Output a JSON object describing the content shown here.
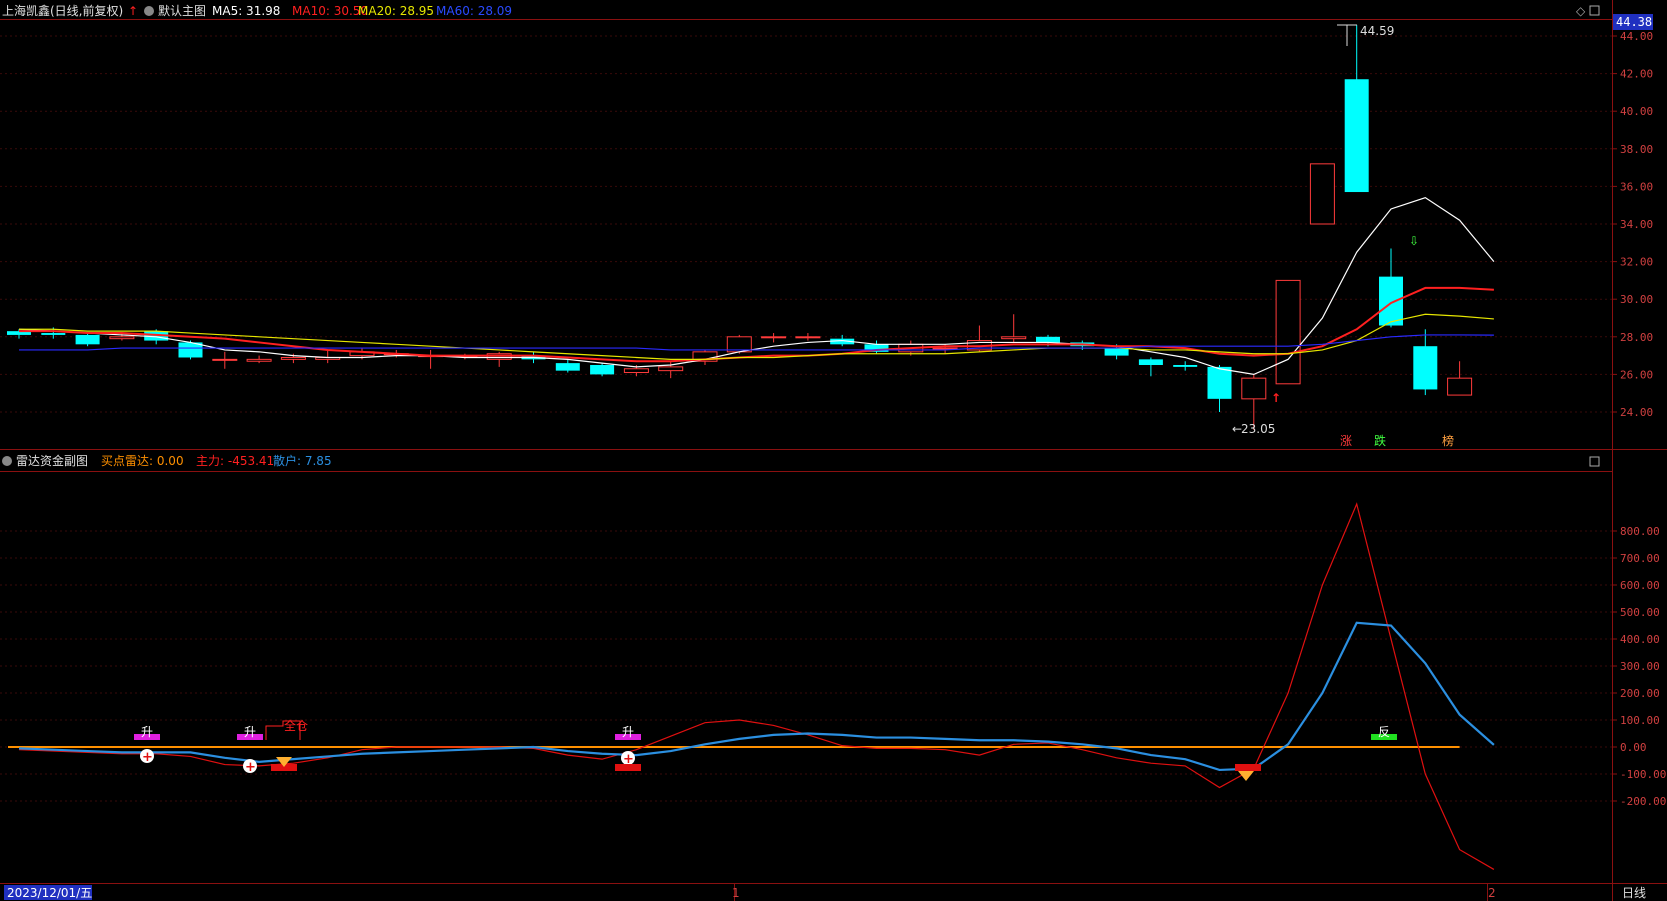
{
  "header": {
    "stock": "上海凯鑫(日线,前复权)",
    "main_label": "默认主图",
    "ma5": "MA5: 31.98",
    "ma10": "MA10: 30.50",
    "ma20": "MA20: 28.95",
    "ma60": "MA60: 28.09"
  },
  "sub_header": {
    "title": "雷达资金副图",
    "buy_radar": "买点雷达: 0.00",
    "main_force": "主力: -453.41",
    "retail": "散户: 7.85"
  },
  "price_axis": {
    "current": "44.38",
    "ticks": [
      "44.00",
      "42.00",
      "40.00",
      "38.00",
      "36.00",
      "34.00",
      "32.00",
      "30.00",
      "28.00",
      "26.00",
      "24.00"
    ]
  },
  "indicator_axis": {
    "ticks": [
      "800.00",
      "700.00",
      "600.00",
      "500.00",
      "400.00",
      "300.00",
      "200.00",
      "100.00",
      "0.00",
      "-100.00",
      "-200.00"
    ]
  },
  "annotations": {
    "high": "44.59",
    "low": "23.05",
    "zhang": "涨",
    "die": "跌",
    "bang": "榜",
    "quanku": "全仓",
    "sheng": "升",
    "fan": "反"
  },
  "bottom": {
    "date": "2023/12/01/五",
    "month1": "1",
    "month2": "2",
    "period": "日线"
  },
  "colors": {
    "up": "#ff3b3b",
    "down": "#00ffff",
    "ma5": "#ffffff",
    "ma10": "#ff2020",
    "ma20": "#e6e600",
    "ma60": "#2a2aff",
    "retail_line": "#2b8fe0",
    "main_line": "#e01010",
    "zero_line": "#ff9000",
    "grid": "#3a0a0a",
    "axis_text": "#d04040"
  },
  "chart_data": [
    {
      "type": "candlestick",
      "title": "上海凯鑫(日线,前复权)",
      "ylim": [
        23,
        45
      ],
      "candles": [
        {
          "o": 28.3,
          "c": 28.1,
          "h": 28.4,
          "l": 27.9
        },
        {
          "o": 28.2,
          "c": 28.1,
          "h": 28.5,
          "l": 27.9
        },
        {
          "o": 28.1,
          "c": 27.6,
          "h": 28.2,
          "l": 27.5
        },
        {
          "o": 27.9,
          "c": 28.0,
          "h": 28.2,
          "l": 27.8
        },
        {
          "o": 28.3,
          "c": 27.8,
          "h": 28.4,
          "l": 27.6
        },
        {
          "o": 27.7,
          "c": 26.9,
          "h": 27.8,
          "l": 26.8
        },
        {
          "o": 26.8,
          "c": 26.8,
          "h": 27.2,
          "l": 26.3
        },
        {
          "o": 26.7,
          "c": 26.8,
          "h": 27.0,
          "l": 26.6
        },
        {
          "o": 26.8,
          "c": 26.9,
          "h": 27.1,
          "l": 26.6
        },
        {
          "o": 26.8,
          "c": 26.9,
          "h": 27.3,
          "l": 26.6
        },
        {
          "o": 27.0,
          "c": 27.2,
          "h": 27.4,
          "l": 26.8
        },
        {
          "o": 27.1,
          "c": 27.1,
          "h": 27.3,
          "l": 26.9
        },
        {
          "o": 27.0,
          "c": 27.0,
          "h": 27.3,
          "l": 26.3
        },
        {
          "o": 27.0,
          "c": 27.0,
          "h": 27.1,
          "l": 26.8
        },
        {
          "o": 26.8,
          "c": 27.1,
          "h": 27.2,
          "l": 26.4
        },
        {
          "o": 27.0,
          "c": 26.8,
          "h": 27.2,
          "l": 26.6
        },
        {
          "o": 26.6,
          "c": 26.2,
          "h": 26.8,
          "l": 26.1
        },
        {
          "o": 26.5,
          "c": 26.0,
          "h": 26.6,
          "l": 25.9
        },
        {
          "o": 26.1,
          "c": 26.3,
          "h": 26.5,
          "l": 25.9
        },
        {
          "o": 26.2,
          "c": 26.4,
          "h": 26.7,
          "l": 25.8
        },
        {
          "o": 26.7,
          "c": 27.2,
          "h": 27.3,
          "l": 26.5
        },
        {
          "o": 27.2,
          "c": 28.0,
          "h": 28.1,
          "l": 27.1
        },
        {
          "o": 28.0,
          "c": 28.0,
          "h": 28.2,
          "l": 27.7
        },
        {
          "o": 28.0,
          "c": 28.0,
          "h": 28.2,
          "l": 27.8
        },
        {
          "o": 27.9,
          "c": 27.6,
          "h": 28.1,
          "l": 27.5
        },
        {
          "o": 27.6,
          "c": 27.2,
          "h": 27.8,
          "l": 27.1
        },
        {
          "o": 27.2,
          "c": 27.6,
          "h": 27.8,
          "l": 27.0
        },
        {
          "o": 27.4,
          "c": 27.4,
          "h": 27.6,
          "l": 27.1
        },
        {
          "o": 27.3,
          "c": 27.8,
          "h": 28.6,
          "l": 27.2
        },
        {
          "o": 27.9,
          "c": 28.0,
          "h": 29.2,
          "l": 27.7
        },
        {
          "o": 28.0,
          "c": 27.7,
          "h": 28.1,
          "l": 27.5
        },
        {
          "o": 27.7,
          "c": 27.5,
          "h": 27.8,
          "l": 27.3
        },
        {
          "o": 27.4,
          "c": 27.0,
          "h": 27.6,
          "l": 26.8
        },
        {
          "o": 26.8,
          "c": 26.5,
          "h": 26.9,
          "l": 25.9
        },
        {
          "o": 26.5,
          "c": 26.4,
          "h": 26.7,
          "l": 26.2
        },
        {
          "o": 26.4,
          "c": 24.7,
          "h": 26.5,
          "l": 24.0
        },
        {
          "o": 24.7,
          "c": 25.8,
          "h": 26.0,
          "l": 23.05
        },
        {
          "o": 25.5,
          "c": 31.0,
          "h": 31.0,
          "l": 25.5
        },
        {
          "o": 34.0,
          "c": 37.2,
          "h": 37.2,
          "l": 34.0
        },
        {
          "o": 41.7,
          "c": 35.7,
          "h": 44.59,
          "l": 35.7
        },
        {
          "o": 31.2,
          "c": 28.6,
          "h": 32.7,
          "l": 28.5
        },
        {
          "o": 27.5,
          "c": 25.2,
          "h": 28.4,
          "l": 24.9
        },
        {
          "o": 24.9,
          "c": 25.8,
          "h": 26.7,
          "l": 24.9
        }
      ],
      "series": [
        {
          "name": "MA5",
          "values": [
            28.4,
            28.3,
            28.2,
            28.1,
            28.0,
            27.7,
            27.3,
            27.2,
            27.0,
            26.9,
            26.9,
            27.0,
            27.0,
            26.9,
            26.9,
            26.9,
            26.8,
            26.6,
            26.4,
            26.5,
            26.8,
            27.2,
            27.5,
            27.7,
            27.8,
            27.6,
            27.6,
            27.6,
            27.7,
            27.7,
            27.7,
            27.6,
            27.5,
            27.2,
            26.9,
            26.3,
            26.0,
            26.8,
            29.0,
            32.5,
            34.8,
            35.4,
            34.2,
            32.0
          ]
        },
        {
          "name": "MA10",
          "values": [
            28.3,
            28.3,
            28.2,
            28.2,
            28.1,
            28.0,
            27.9,
            27.7,
            27.5,
            27.3,
            27.2,
            27.1,
            27.0,
            27.0,
            27.0,
            27.0,
            26.9,
            26.8,
            26.7,
            26.7,
            26.8,
            26.9,
            27.0,
            27.0,
            27.1,
            27.3,
            27.4,
            27.5,
            27.5,
            27.6,
            27.6,
            27.6,
            27.5,
            27.5,
            27.4,
            27.1,
            27.0,
            27.1,
            27.5,
            28.4,
            29.8,
            30.6,
            30.6,
            30.5
          ]
        },
        {
          "name": "MA20",
          "values": [
            28.4,
            28.4,
            28.3,
            28.3,
            28.3,
            28.2,
            28.1,
            28.0,
            27.9,
            27.8,
            27.7,
            27.6,
            27.5,
            27.4,
            27.3,
            27.2,
            27.1,
            27.0,
            26.9,
            26.8,
            26.8,
            26.9,
            26.9,
            27.0,
            27.1,
            27.1,
            27.1,
            27.1,
            27.2,
            27.3,
            27.4,
            27.4,
            27.4,
            27.3,
            27.3,
            27.2,
            27.1,
            27.1,
            27.3,
            27.8,
            28.8,
            29.2,
            29.1,
            28.95
          ]
        },
        {
          "name": "MA60",
          "values": [
            27.3,
            27.3,
            27.3,
            27.4,
            27.4,
            27.4,
            27.4,
            27.4,
            27.4,
            27.4,
            27.4,
            27.4,
            27.4,
            27.4,
            27.4,
            27.4,
            27.4,
            27.4,
            27.4,
            27.3,
            27.3,
            27.3,
            27.3,
            27.3,
            27.3,
            27.3,
            27.3,
            27.3,
            27.4,
            27.4,
            27.4,
            27.4,
            27.4,
            27.5,
            27.5,
            27.5,
            27.5,
            27.5,
            27.6,
            27.8,
            28.0,
            28.1,
            28.1,
            28.09
          ]
        }
      ]
    },
    {
      "type": "line",
      "title": "雷达资金副图",
      "ylim": [
        -480,
        900
      ],
      "series": [
        {
          "name": "主力",
          "values": [
            -10,
            -15,
            -20,
            -25,
            -25,
            -35,
            -65,
            -70,
            -60,
            -40,
            -10,
            0,
            0,
            0,
            0,
            -5,
            -30,
            -45,
            -10,
            40,
            90,
            100,
            80,
            45,
            5,
            -5,
            -5,
            -10,
            -30,
            10,
            15,
            -10,
            -40,
            -60,
            -70,
            -150,
            -80,
            200,
            600,
            900,
            400,
            -100,
            -380,
            -453.41
          ]
        },
        {
          "name": "散户",
          "values": [
            -5,
            -10,
            -15,
            -20,
            -20,
            -20,
            -40,
            -55,
            -45,
            -35,
            -25,
            -20,
            -15,
            -10,
            -5,
            0,
            -15,
            -25,
            -30,
            -15,
            10,
            30,
            45,
            50,
            45,
            35,
            35,
            30,
            25,
            25,
            20,
            10,
            -5,
            -30,
            -45,
            -85,
            -80,
            10,
            200,
            460,
            450,
            310,
            120,
            7.85
          ]
        }
      ]
    }
  ]
}
